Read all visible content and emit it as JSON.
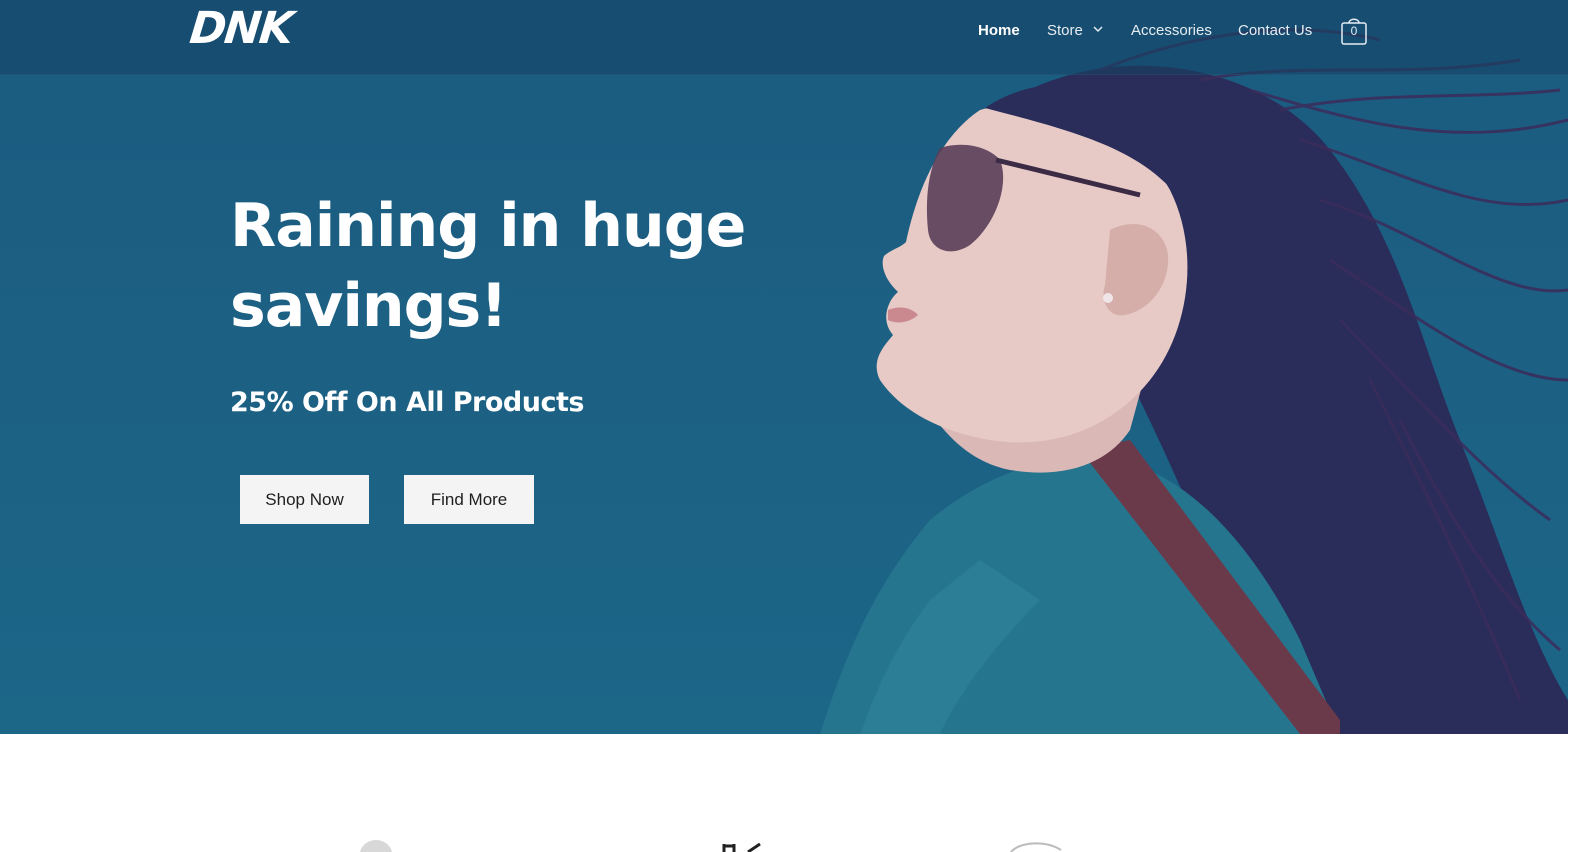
{
  "brand": {
    "logo_text": "DNK"
  },
  "nav": {
    "items": [
      {
        "label": "Home",
        "active": true
      },
      {
        "label": "Store",
        "active": false,
        "has_dropdown": true
      },
      {
        "label": "Accessories",
        "active": false
      },
      {
        "label": "Contact Us",
        "active": false
      }
    ],
    "cart_count": "0"
  },
  "hero": {
    "headline": "Raining in huge savings!",
    "subheadline": "25% Off On All Products",
    "buttons": {
      "shop_now": "Shop Now",
      "find_more": "Find More"
    }
  },
  "colors": {
    "hero_bg": "#1c6184",
    "header_bg": "#184b6d",
    "button_bg": "#f4f4f4",
    "text_light": "#ffffff"
  },
  "icons": {
    "cart": "shopping-bag-icon",
    "dropdown": "chevron-down-icon"
  }
}
